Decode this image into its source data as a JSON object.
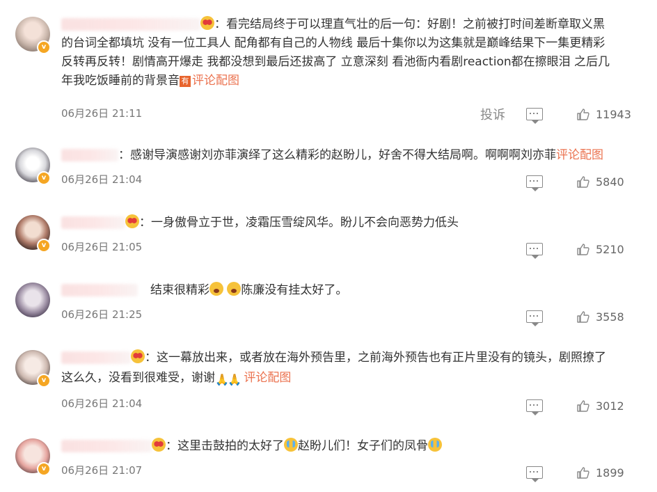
{
  "comments": [
    {
      "lines": [
        "：看完结局终于可以理直气壮的后一句：好剧！之前被打时间差断章取义黑",
        "的台词全都填坑 没有一位工具人 配角都有自己的人物线 最后十集你以为这集就是巅峰结果下一集更精彩",
        "反转再反转！剧情高开爆走 我都没想到最后还拔高了 立意深刻 看池衙内看剧reaction都在擦眼泪 之后几",
        "年我吃饭睡前的背景音"
      ],
      "tag": "有",
      "link": "评论配图",
      "time": "06月26日 21:11",
      "report": "投诉",
      "likes": "11943"
    },
    {
      "text": "：感谢导演感谢刘亦菲演绎了这么精彩的赵盼儿，好舍不得大结局啊。啊啊啊刘亦菲",
      "link": "评论配图",
      "time": "06月26日 21:04",
      "likes": "5840"
    },
    {
      "text": "：一身傲骨立于世，凌霜压雪绽风华。盼儿不会向恶势力低头",
      "time": "06月26日 21:05",
      "likes": "5210"
    },
    {
      "text_a": "结束很精彩",
      "text_b": "陈廉没有挂太好了。",
      "time": "06月26日 21:25",
      "likes": "3558"
    },
    {
      "line1": "：这一幕放出来，或者放在海外预告里，之前海外预告也有正片里没有的镜头，剧照撩了",
      "line2": "这么久，没看到很难受，谢谢",
      "link": "评论配图",
      "time": "06月26日 21:04",
      "likes": "3012"
    },
    {
      "text_a": "：这里击鼓拍的太好了",
      "text_b": "赵盼儿们！女子们的凤骨",
      "time": "06月26日 21:07",
      "likes": "1899"
    }
  ],
  "icons": {
    "comment": "comment-icon",
    "like": "thumbs-up-icon",
    "verified": "verified-badge-icon",
    "verified_letter": "v"
  },
  "colors": {
    "link": "#eb7350",
    "badge": "#f5a623"
  }
}
